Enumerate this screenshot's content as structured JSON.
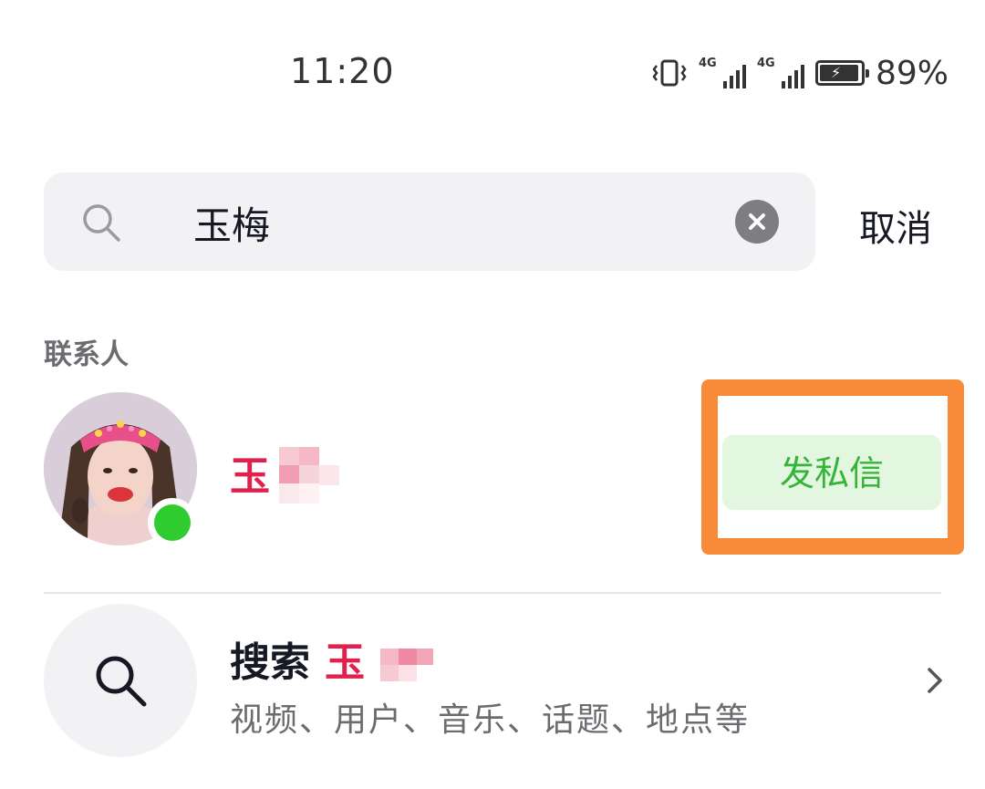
{
  "status_bar": {
    "time": "11:20",
    "network_1": "4G",
    "network_2": "4G",
    "battery_percent": "89%",
    "icons": [
      "vibrate-icon",
      "signal-icon",
      "signal-icon",
      "battery-charging-icon"
    ]
  },
  "search": {
    "query": "玉梅",
    "placeholder": "",
    "cancel_label": "取消",
    "icons": [
      "search-icon",
      "clear-icon"
    ]
  },
  "contacts": {
    "section_title": "联系人",
    "items": [
      {
        "name": "玉",
        "online": true,
        "action_label": "发私信"
      }
    ]
  },
  "suggestion": {
    "prefix": "搜索",
    "keyword": "玉",
    "subtitle": "视频、用户、音乐、话题、地点等"
  },
  "colors": {
    "accent_red": "#e1204d",
    "highlight_orange": "#f98a37",
    "dm_green": "#36b339",
    "dm_bg": "#e3f6df",
    "online_green": "#2ecc2e"
  }
}
